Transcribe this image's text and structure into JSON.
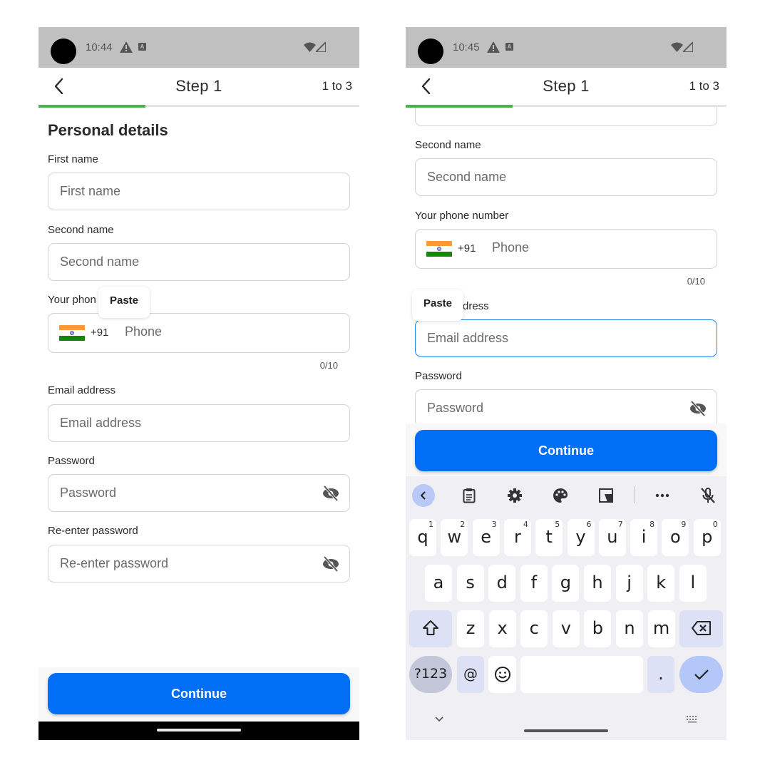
{
  "left": {
    "status": {
      "time": "10:44"
    },
    "appbar": {
      "title": "Step 1",
      "step": "1 to 3",
      "progress_fraction": 0.333
    },
    "section_title": "Personal details",
    "fields": {
      "first_name": {
        "label": "First name",
        "placeholder": "First name"
      },
      "second_name": {
        "label": "Second name",
        "placeholder": "Second name"
      },
      "phone": {
        "label": "Your phone number",
        "label_visible": "Your phon",
        "country_code": "+91",
        "placeholder": "Phone",
        "counter": "0/10"
      },
      "email": {
        "label": "Email address",
        "placeholder": "Email address"
      },
      "password": {
        "label": "Password",
        "placeholder": "Password"
      },
      "reenter": {
        "label": "Re-enter password",
        "placeholder": "Re-enter password"
      }
    },
    "paste_label": "Paste",
    "continue_label": "Continue"
  },
  "right": {
    "status": {
      "time": "10:45"
    },
    "appbar": {
      "title": "Step 1",
      "step": "1 to 3",
      "progress_fraction": 0.333
    },
    "fields": {
      "second_name": {
        "label": "Second name",
        "placeholder": "Second name"
      },
      "phone": {
        "label": "Your phone number",
        "country_code": "+91",
        "placeholder": "Phone",
        "counter": "0/10"
      },
      "email": {
        "label": "Email address",
        "label_visible": "dress",
        "placeholder": "Email address"
      },
      "password": {
        "label": "Password",
        "placeholder": "Password"
      }
    },
    "paste_label": "Paste",
    "continue_label": "Continue",
    "keyboard": {
      "toolbar": [
        "back",
        "clipboard",
        "settings",
        "theme",
        "resize",
        "more",
        "mic-off"
      ],
      "row1": [
        {
          "k": "q",
          "h": "1"
        },
        {
          "k": "w",
          "h": "2"
        },
        {
          "k": "e",
          "h": "3"
        },
        {
          "k": "r",
          "h": "4"
        },
        {
          "k": "t",
          "h": "5"
        },
        {
          "k": "y",
          "h": "6"
        },
        {
          "k": "u",
          "h": "7"
        },
        {
          "k": "i",
          "h": "8"
        },
        {
          "k": "o",
          "h": "9"
        },
        {
          "k": "p",
          "h": "0"
        }
      ],
      "row2": [
        "a",
        "s",
        "d",
        "f",
        "g",
        "h",
        "j",
        "k",
        "l"
      ],
      "row3": [
        "z",
        "x",
        "c",
        "v",
        "b",
        "n",
        "m"
      ],
      "symbols_label": "?123",
      "at_label": "@",
      "period_label": "."
    }
  },
  "colors": {
    "accent": "#006ff5",
    "progress": "#4caf50",
    "focus": "#1e88e5"
  }
}
